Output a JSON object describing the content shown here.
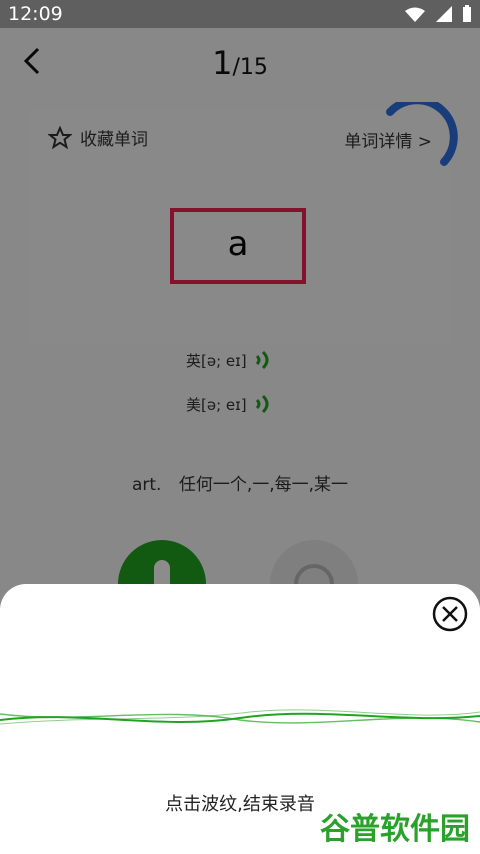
{
  "status": {
    "time": "12:09"
  },
  "header": {
    "current": "1",
    "total": "/15"
  },
  "card": {
    "favorite_label": "收藏单词",
    "detail_label": "单词详情 >"
  },
  "word": {
    "text": "a"
  },
  "phonetics": {
    "uk": "英[ə; eɪ]",
    "us": "美[ə; eɪ]"
  },
  "meaning": {
    "pos": "art.",
    "text": "任何一个,一,每一,某一"
  },
  "sheet": {
    "hint": "点击波纹,结束录音"
  },
  "watermark": {
    "text": "谷普软件园"
  },
  "colors": {
    "accent_green": "#22a222",
    "highlight_red": "#f0214f",
    "loader_blue": "#2f6fe0"
  },
  "icons": [
    "wifi-icon",
    "signal-icon",
    "battery-icon",
    "back-icon",
    "star-icon",
    "speaker-icon",
    "close-circle-icon",
    "microphone-icon"
  ]
}
